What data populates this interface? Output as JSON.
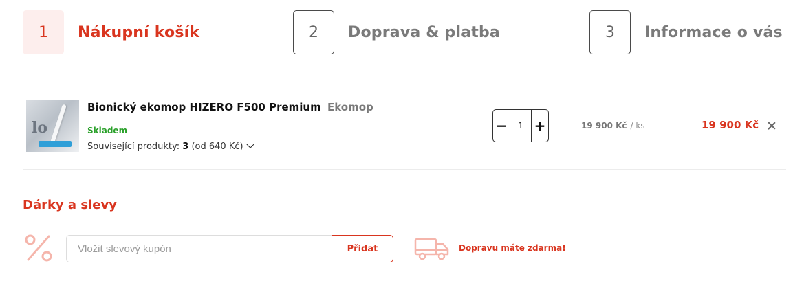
{
  "steps": [
    {
      "number": "1",
      "label": "Nákupní košík",
      "active": true
    },
    {
      "number": "2",
      "label": "Doprava & platba",
      "active": false
    },
    {
      "number": "3",
      "label": "Informace o vás",
      "active": false
    }
  ],
  "cart": {
    "items": [
      {
        "name": "Bionický ekomop HIZERO F500 Premium",
        "brand": "Ekomop",
        "stock": "Skladem",
        "related_prefix": "Související produkty: ",
        "related_count": "3",
        "related_suffix": " (od 640 Kč)",
        "quantity": "1",
        "minus": "−",
        "plus": "+",
        "unit_price": "19 900 Kč",
        "unit_per": "/ ks",
        "total_price": "19 900 Kč"
      }
    ]
  },
  "discounts": {
    "title": "Dárky a slevy",
    "coupon_placeholder": "Vložit slevový kupón",
    "coupon_value": "",
    "add_button": "Přidat",
    "free_shipping": "Dopravu máte zdarma!"
  },
  "icons": {
    "percent": "percent-icon",
    "truck": "truck-icon",
    "remove": "close-icon",
    "chevron": "chevron-down-icon"
  },
  "colors": {
    "accent": "#d9351f",
    "accent_light": "#fdeeed",
    "in_stock": "#2aa02a",
    "icon_light": "#f5b5ab"
  }
}
